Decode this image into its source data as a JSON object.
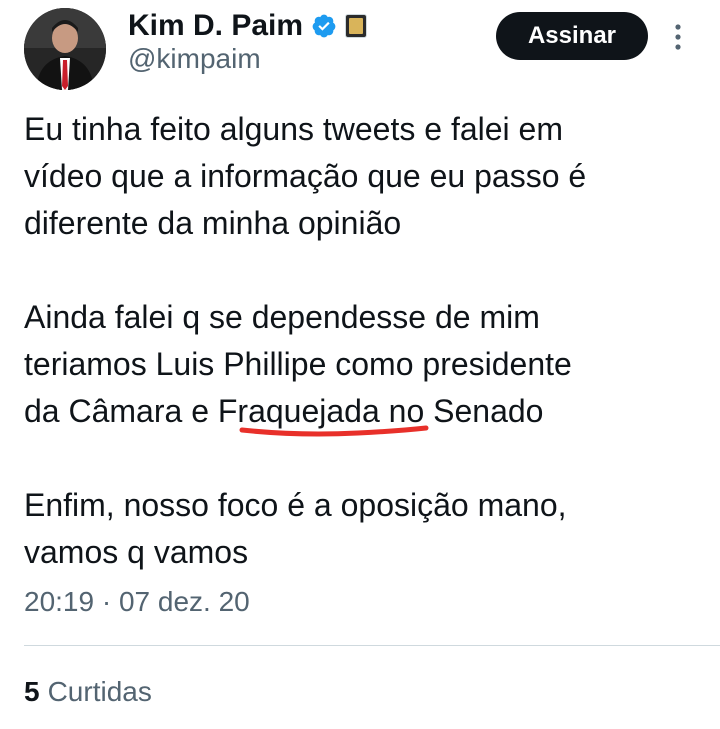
{
  "author": {
    "name": "Kim D. Paim",
    "handle": "@kimpaim",
    "verified": true,
    "avatar_icon": "profile-photo"
  },
  "follow_button": {
    "label": "Assinar"
  },
  "more_icon": "more-vertical-icon",
  "tweet": {
    "paragraphs": [
      "Eu tinha feito alguns tweets e falei em\nvídeo que a informação que eu passo é\ndiferente da minha opinião",
      "Ainda falei q se dependesse de mim\nteriamos Luis Phillipe como presidente\nda Câmara e Fraquejada no Senado",
      "Enfim, nosso foco é a oposição mano,\nvamos q vamos"
    ],
    "highlighted_word": "Fraquejada",
    "highlight_color": "#e8302a",
    "timestamp": "20:19 · 07 dez. 20"
  },
  "stats": {
    "likes_count": "5",
    "likes_label": "Curtidas"
  },
  "colors": {
    "text_primary": "#0f1419",
    "text_secondary": "#536471",
    "verified_blue": "#1d9bf0",
    "button_bg": "#0f1419",
    "divider": "#cfd9de"
  }
}
